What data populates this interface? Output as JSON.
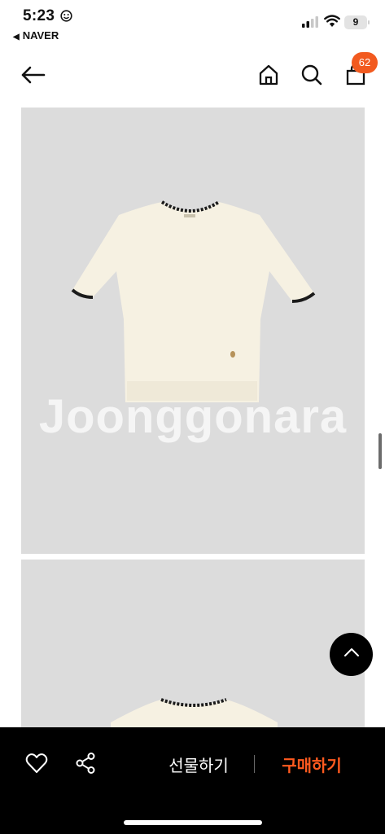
{
  "status_bar": {
    "time": "5:23",
    "back_app": "NAVER",
    "battery": "9",
    "smiley_icon": "smiley-icon",
    "signal_icon": "cell-signal-icon",
    "wifi_icon": "wifi-icon"
  },
  "header": {
    "back_icon": "arrow-left-icon",
    "home_icon": "home-icon",
    "search_icon": "search-icon",
    "cart_icon": "shopping-bag-icon",
    "cart_count": "62",
    "badge_color": "#f25a1f"
  },
  "product_images": {
    "watermark": "Joonggonara",
    "background_color": "#dcdcdc"
  },
  "floating": {
    "scroll_top_icon": "chevron-up-icon"
  },
  "bottom_bar": {
    "wishlist_icon": "heart-icon",
    "share_icon": "share-icon",
    "gift_label": "선물하기",
    "buy_label": "구매하기",
    "buy_color": "#ff5a1f"
  }
}
